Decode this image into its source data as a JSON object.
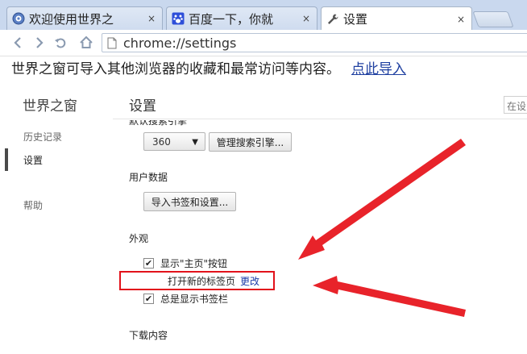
{
  "browser": {
    "tabs": [
      {
        "title": "欢迎使用世界之",
        "close": "×"
      },
      {
        "title": "百度一下，你就",
        "close": "×"
      },
      {
        "title": "设置",
        "close": "×"
      }
    ],
    "address": "chrome://settings"
  },
  "import_bar": {
    "message": "世界之窗可导入其他浏览器的收藏和最常访问等内容。",
    "link": "点此导入"
  },
  "sidebar": {
    "brand": "世界之窗",
    "items": [
      {
        "label": "历史记录"
      },
      {
        "label": "设置"
      },
      {
        "label": "帮助"
      }
    ]
  },
  "settings": {
    "title": "设置",
    "search_placeholder": "在设",
    "clipped_heading": "默认搜索引擎",
    "search_engine": {
      "selected": "360",
      "manage_button": "管理搜索引擎..."
    },
    "user_data": {
      "heading": "用户数据",
      "import_button": "导入书签和设置..."
    },
    "appearance": {
      "heading": "外观",
      "show_home_button": "显示\"主页\"按钮",
      "home_page_value": "打开新的标签页",
      "change_link": "更改",
      "always_show_bookmarks": "总是显示书签栏"
    },
    "downloads": {
      "heading": "下载内容"
    }
  },
  "colors": {
    "highlight": "#e2121b",
    "arrow": "#e8232a",
    "link": "#1a3aa8"
  }
}
